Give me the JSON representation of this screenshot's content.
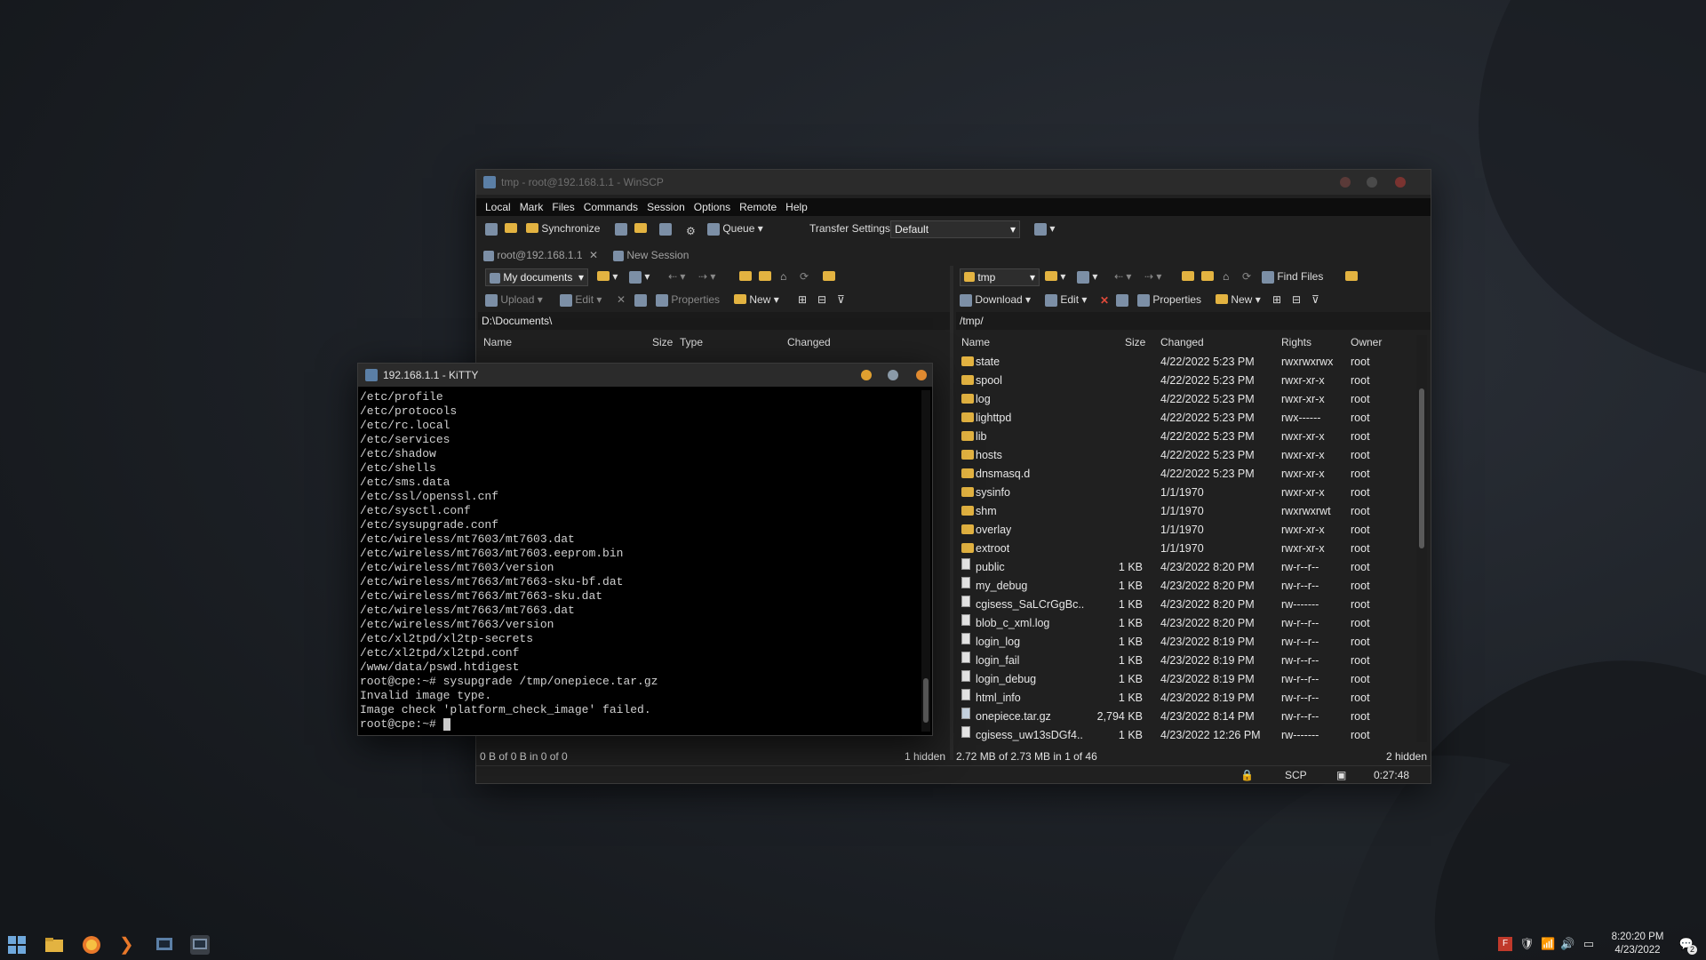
{
  "winscp": {
    "title": "tmp - root@192.168.1.1 - WinSCP",
    "menu": [
      "Local",
      "Mark",
      "Files",
      "Commands",
      "Session",
      "Options",
      "Remote",
      "Help"
    ],
    "toolbar": {
      "synchronize": "Synchronize",
      "queue": "Queue",
      "transfer_settings": "Transfer Settings",
      "transfer_default": "Default"
    },
    "tabs": {
      "session": "root@192.168.1.1",
      "new_session": "New Session"
    },
    "local": {
      "location": "My documents",
      "upload": "Upload",
      "edit": "Edit",
      "properties": "Properties",
      "new": "New",
      "path": "D:\\Documents\\",
      "columns": {
        "name": "Name",
        "size": "Size",
        "type": "Type",
        "changed": "Changed"
      },
      "status": "0 B of 0 B in 0 of 0",
      "hidden": "1 hidden"
    },
    "remote": {
      "location": "tmp",
      "find_files": "Find Files",
      "download": "Download",
      "edit": "Edit",
      "properties": "Properties",
      "new": "New",
      "path": "/tmp/",
      "columns": {
        "name": "Name",
        "size": "Size",
        "changed": "Changed",
        "rights": "Rights",
        "owner": "Owner"
      },
      "rows": [
        {
          "icon": "folder",
          "name": "state",
          "size": "",
          "changed": "4/22/2022 5:23 PM",
          "rights": "rwxrwxrwx",
          "owner": "root"
        },
        {
          "icon": "folder",
          "name": "spool",
          "size": "",
          "changed": "4/22/2022 5:23 PM",
          "rights": "rwxr-xr-x",
          "owner": "root"
        },
        {
          "icon": "folder",
          "name": "log",
          "size": "",
          "changed": "4/22/2022 5:23 PM",
          "rights": "rwxr-xr-x",
          "owner": "root"
        },
        {
          "icon": "folder",
          "name": "lighttpd",
          "size": "",
          "changed": "4/22/2022 5:23 PM",
          "rights": "rwx------",
          "owner": "root"
        },
        {
          "icon": "folder",
          "name": "lib",
          "size": "",
          "changed": "4/22/2022 5:23 PM",
          "rights": "rwxr-xr-x",
          "owner": "root"
        },
        {
          "icon": "folder",
          "name": "hosts",
          "size": "",
          "changed": "4/22/2022 5:23 PM",
          "rights": "rwxr-xr-x",
          "owner": "root"
        },
        {
          "icon": "folder",
          "name": "dnsmasq.d",
          "size": "",
          "changed": "4/22/2022 5:23 PM",
          "rights": "rwxr-xr-x",
          "owner": "root"
        },
        {
          "icon": "folder",
          "name": "sysinfo",
          "size": "",
          "changed": "1/1/1970",
          "rights": "rwxr-xr-x",
          "owner": "root"
        },
        {
          "icon": "folder",
          "name": "shm",
          "size": "",
          "changed": "1/1/1970",
          "rights": "rwxrwxrwt",
          "owner": "root"
        },
        {
          "icon": "folder",
          "name": "overlay",
          "size": "",
          "changed": "1/1/1970",
          "rights": "rwxr-xr-x",
          "owner": "root"
        },
        {
          "icon": "folder",
          "name": "extroot",
          "size": "",
          "changed": "1/1/1970",
          "rights": "rwxr-xr-x",
          "owner": "root"
        },
        {
          "icon": "file",
          "name": "public",
          "size": "1 KB",
          "changed": "4/23/2022 8:20 PM",
          "rights": "rw-r--r--",
          "owner": "root"
        },
        {
          "icon": "file",
          "name": "my_debug",
          "size": "1 KB",
          "changed": "4/23/2022 8:20 PM",
          "rights": "rw-r--r--",
          "owner": "root"
        },
        {
          "icon": "file",
          "name": "cgisess_SaLCrGgBc...",
          "size": "1 KB",
          "changed": "4/23/2022 8:20 PM",
          "rights": "rw-------",
          "owner": "root"
        },
        {
          "icon": "file",
          "name": "blob_c_xml.log",
          "size": "1 KB",
          "changed": "4/23/2022 8:20 PM",
          "rights": "rw-r--r--",
          "owner": "root"
        },
        {
          "icon": "file",
          "name": "login_log",
          "size": "1 KB",
          "changed": "4/23/2022 8:19 PM",
          "rights": "rw-r--r--",
          "owner": "root"
        },
        {
          "icon": "file",
          "name": "login_fail",
          "size": "1 KB",
          "changed": "4/23/2022 8:19 PM",
          "rights": "rw-r--r--",
          "owner": "root"
        },
        {
          "icon": "file",
          "name": "login_debug",
          "size": "1 KB",
          "changed": "4/23/2022 8:19 PM",
          "rights": "rw-r--r--",
          "owner": "root"
        },
        {
          "icon": "file",
          "name": "html_info",
          "size": "1 KB",
          "changed": "4/23/2022 8:19 PM",
          "rights": "rw-r--r--",
          "owner": "root"
        },
        {
          "icon": "archive",
          "name": "onepiece.tar.gz",
          "size": "2,794 KB",
          "changed": "4/23/2022 8:14 PM",
          "rights": "rw-r--r--",
          "owner": "root"
        },
        {
          "icon": "file",
          "name": "cgisess_uw13sDGf4...",
          "size": "1 KB",
          "changed": "4/23/2022 12:26 PM",
          "rights": "rw-------",
          "owner": "root"
        }
      ],
      "status": "2.72 MB of 2.73 MB in 1 of 46",
      "hidden": "2 hidden"
    },
    "bottom": {
      "protocol": "SCP",
      "elapsed": "0:27:48"
    }
  },
  "kitty": {
    "title": "192.168.1.1 - KiTTY",
    "lines": [
      "/etc/profile",
      "/etc/protocols",
      "/etc/rc.local",
      "/etc/services",
      "/etc/shadow",
      "/etc/shells",
      "/etc/sms.data",
      "/etc/ssl/openssl.cnf",
      "/etc/sysctl.conf",
      "/etc/sysupgrade.conf",
      "/etc/wireless/mt7603/mt7603.dat",
      "/etc/wireless/mt7603/mt7603.eeprom.bin",
      "/etc/wireless/mt7603/version",
      "/etc/wireless/mt7663/mt7663-sku-bf.dat",
      "/etc/wireless/mt7663/mt7663-sku.dat",
      "/etc/wireless/mt7663/mt7663.dat",
      "/etc/wireless/mt7663/version",
      "/etc/xl2tpd/xl2tp-secrets",
      "/etc/xl2tpd/xl2tpd.conf",
      "/www/data/pswd.htdigest",
      "root@cpe:~# sysupgrade /tmp/onepiece.tar.gz",
      "Invalid image type.",
      "Image check 'platform_check_image' failed."
    ],
    "prompt": "root@cpe:~# "
  },
  "taskbar": {
    "time": "8:20:20 PM",
    "date": "4/23/2022",
    "notifications": "2"
  },
  "colors": {
    "accent_folder": "#e3b341",
    "desktop": "#1c2026",
    "window": "#202020"
  }
}
